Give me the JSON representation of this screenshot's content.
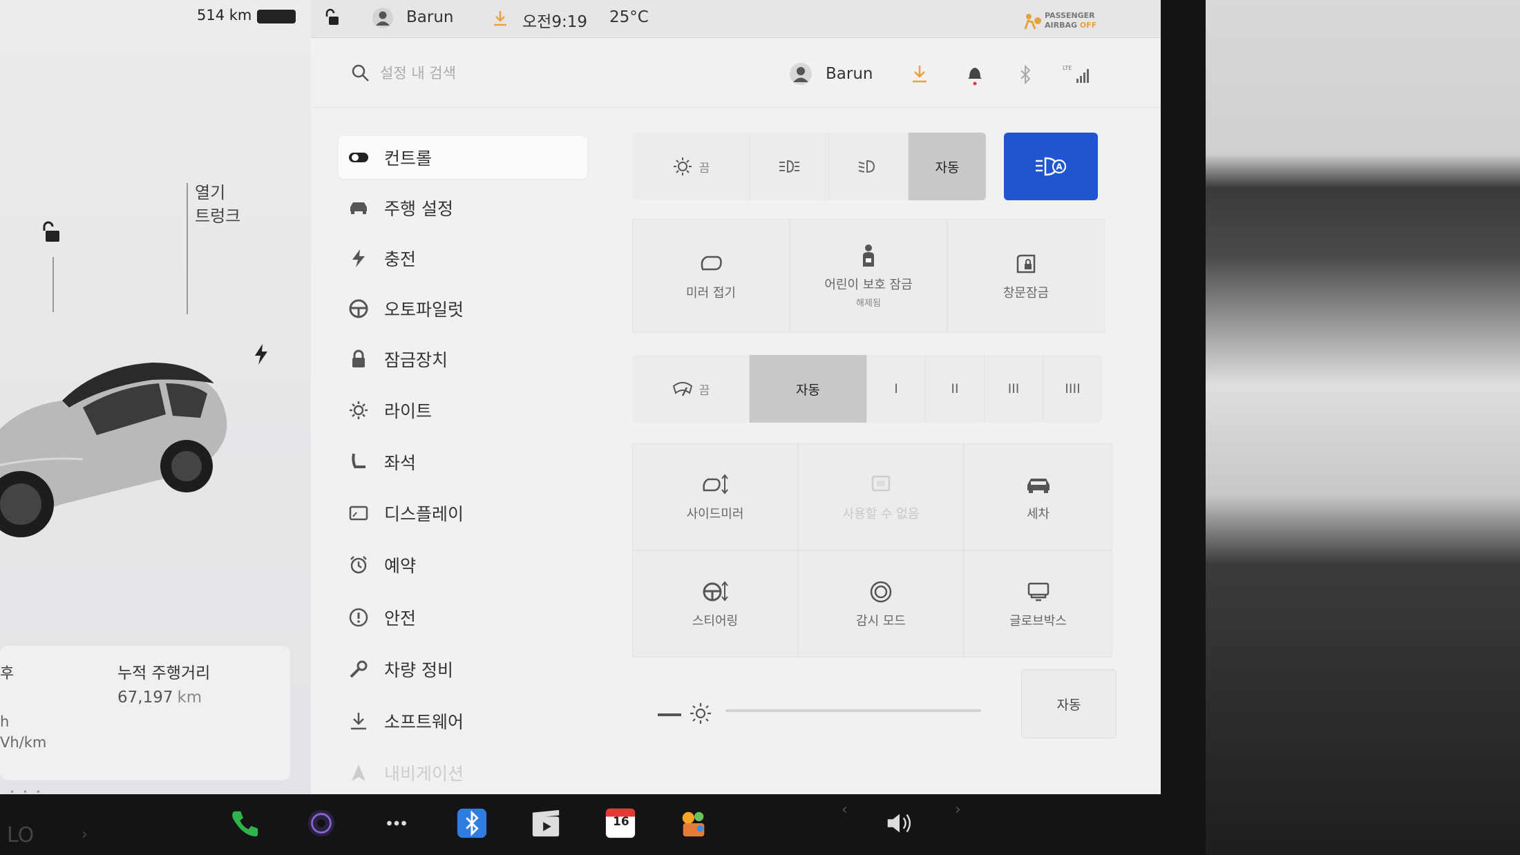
{
  "status": {
    "range": "514 km",
    "user": "Barun",
    "time": "오전9:19",
    "temperature": "25°C",
    "airbag_line1": "PASSENGER",
    "airbag_line2": "AIRBAG",
    "airbag_state": "OFF"
  },
  "car_panel": {
    "trunk_label_1": "열기",
    "trunk_label_2": "트렁크",
    "odometer_title": "누적 주행거리",
    "odometer_value": "67,197",
    "odometer_unit": "km",
    "frag_1": "후",
    "frag_2": "h",
    "frag_3": "Vh/km"
  },
  "header": {
    "search_placeholder": "설정 내 검색",
    "user": "Barun"
  },
  "sidebar": {
    "items": [
      {
        "label": "컨트롤",
        "icon": "toggle-icon"
      },
      {
        "label": "주행 설정",
        "icon": "car-icon"
      },
      {
        "label": "충전",
        "icon": "bolt-icon"
      },
      {
        "label": "오토파일럿",
        "icon": "steering-wheel-icon"
      },
      {
        "label": "잠금장치",
        "icon": "lock-icon"
      },
      {
        "label": "라이트",
        "icon": "sun-icon"
      },
      {
        "label": "좌석",
        "icon": "seat-icon"
      },
      {
        "label": "디스플레이",
        "icon": "display-icon"
      },
      {
        "label": "예약",
        "icon": "alarm-clock-icon"
      },
      {
        "label": "안전",
        "icon": "alert-circle-icon"
      },
      {
        "label": "차량 정비",
        "icon": "wrench-icon"
      },
      {
        "label": "소프트웨어",
        "icon": "download-icon"
      },
      {
        "label": "내비게이션",
        "icon": "navigation-icon"
      }
    ]
  },
  "controls": {
    "headlights": {
      "off_label": "끔",
      "auto_label": "자동",
      "selected": "자동"
    },
    "tiles_row1": {
      "mirror_fold": "미러 접기",
      "child_lock": "어린이 보호 잠금",
      "child_lock_sub": "해제됨",
      "window_lock": "창문잠금"
    },
    "wipers": {
      "off_label": "끔",
      "auto_label": "자동",
      "speed_1": "I",
      "speed_2": "II",
      "speed_3": "III",
      "speed_4": "IIII",
      "selected": "자동"
    },
    "tiles_row2": {
      "side_mirror": "사이드미러",
      "unavailable": "사용할 수 없음",
      "car_wash": "세차"
    },
    "tiles_row3": {
      "steering": "스티어링",
      "sentry_mode": "감시 모드",
      "glovebox": "글로브박스"
    },
    "brightness_auto": "자동"
  },
  "dock": {
    "calendar_day": "16",
    "left_text": "LO"
  },
  "colors": {
    "accent_blue": "#1f56cf",
    "download_orange": "#e8a23a",
    "bell_dot_red": "#e03a3a",
    "phone_green": "#2fb34a",
    "bluetooth_blue": "#2f7de1"
  }
}
